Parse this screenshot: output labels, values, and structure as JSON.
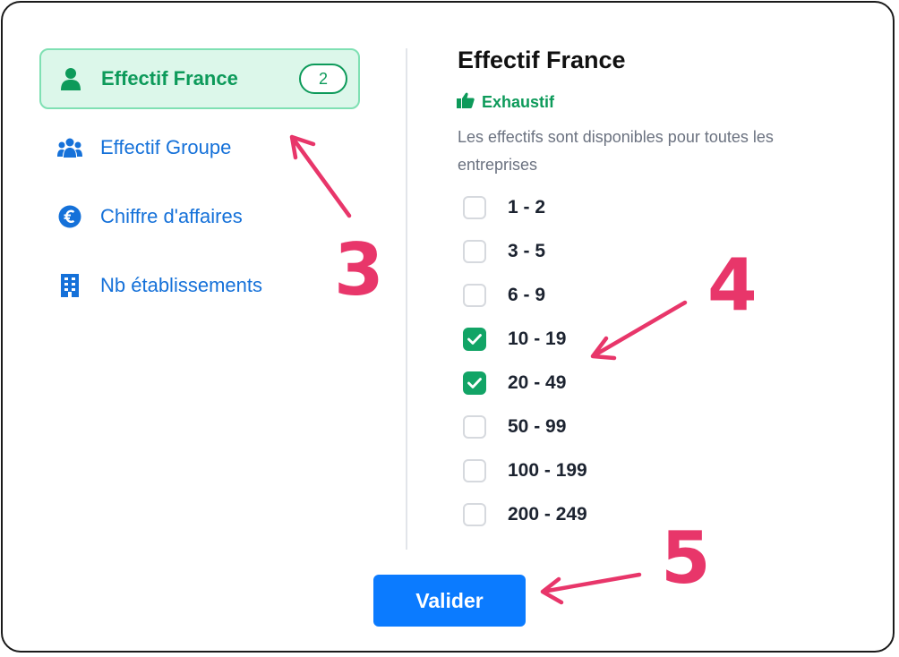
{
  "sidebar": {
    "items": [
      {
        "label": "Effectif France",
        "icon": "person-icon",
        "active": true,
        "badge": "2"
      },
      {
        "label": "Effectif Groupe",
        "icon": "group-icon",
        "active": false
      },
      {
        "label": "Chiffre d'affaires",
        "icon": "euro-icon",
        "active": false
      },
      {
        "label": "Nb établissements",
        "icon": "building-icon",
        "active": false
      }
    ]
  },
  "panel": {
    "title": "Effectif France",
    "tag": {
      "label": "Exhaustif",
      "icon": "thumbs-up-icon"
    },
    "description": "Les effectifs sont disponibles pour toutes les entreprises",
    "options": [
      {
        "label": "1 - 2",
        "checked": false
      },
      {
        "label": "3 - 5",
        "checked": false
      },
      {
        "label": "6 - 9",
        "checked": false
      },
      {
        "label": "10 - 19",
        "checked": true
      },
      {
        "label": "20 - 49",
        "checked": true
      },
      {
        "label": "50 - 99",
        "checked": false
      },
      {
        "label": "100 - 199",
        "checked": false
      },
      {
        "label": "200 - 249",
        "checked": false
      }
    ]
  },
  "submit_label": "Valider",
  "annotations": {
    "callout_3": "3",
    "callout_4": "4",
    "callout_5": "5"
  },
  "colors": {
    "accent_green": "#0d9a5a",
    "link_blue": "#1571d9",
    "button_blue": "#0b7bff",
    "annotation_pink": "#e8366a"
  }
}
